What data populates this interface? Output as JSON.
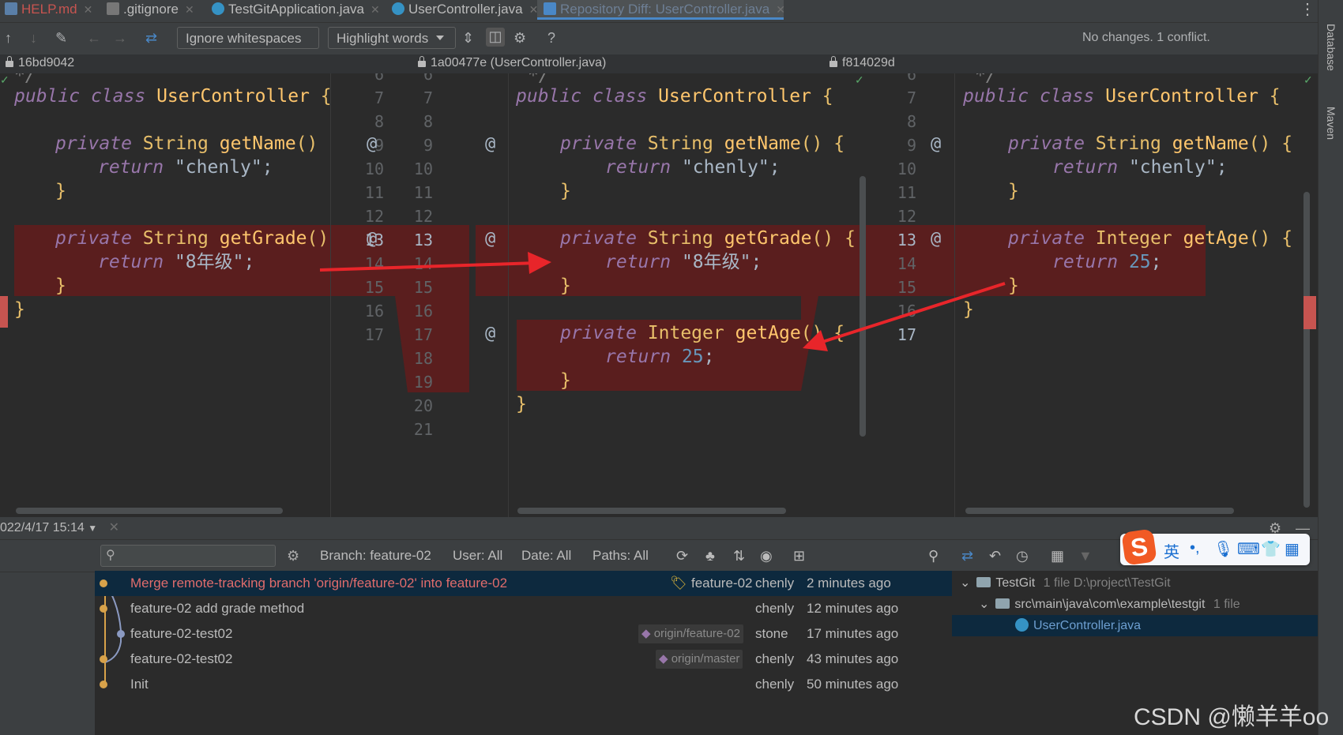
{
  "tabs": [
    {
      "label": "HELP.md",
      "icon": "markdown-icon"
    },
    {
      "label": ".gitignore",
      "icon": "gitignore-icon"
    },
    {
      "label": "TestGitApplication.java",
      "icon": "java-class-icon"
    },
    {
      "label": "UserController.java",
      "icon": "java-class-icon"
    },
    {
      "label": "Repository Diff: UserController.java",
      "icon": "diff-icon"
    }
  ],
  "toolbar": {
    "whitespace_option": "Ignore whitespaces",
    "highlight_option": "Highlight words",
    "help": "?",
    "status": "No changes. 1 conflict."
  },
  "revisions": {
    "left": "16bd9042",
    "center": "1a00477e (UserController.java)",
    "right": "f814029d"
  },
  "code": {
    "comment_end": "*/",
    "class_decl": {
      "kw1": "public",
      "kw2": "class",
      "name": "UserController",
      "brace": "{"
    },
    "getName": {
      "kw": "private",
      "type": "String",
      "name": "getName",
      "paren": "()",
      "brace": "{",
      "ret": "return",
      "value": "\"chenly\"",
      "semi": ";",
      "close": "}"
    },
    "getGrade": {
      "kw": "private",
      "type": "String",
      "name": "getGrade",
      "paren": "()",
      "brace": "{",
      "ret": "return",
      "value": "\"8年级\"",
      "semi": ";",
      "close": "}"
    },
    "getAge": {
      "kw": "private",
      "type": "Integer",
      "name": "getAge",
      "paren": "()",
      "brace": "{",
      "ret": "return",
      "value": "25",
      "semi": ";",
      "close": "}"
    },
    "class_close": "}"
  },
  "gutter": {
    "left_numbers": [
      "6",
      "7",
      "8",
      "9",
      "10",
      "11",
      "12",
      "13",
      "14",
      "15",
      "16",
      "17"
    ],
    "center_numbers": [
      "6",
      "7",
      "8",
      "9",
      "10",
      "11",
      "12",
      "13",
      "14",
      "15",
      "16",
      "17",
      "18",
      "19",
      "20",
      "21"
    ],
    "right_numbers": [
      "6",
      "7",
      "8",
      "9",
      "10",
      "11",
      "12",
      "13",
      "14",
      "15",
      "16",
      "17"
    ],
    "annotation_marker": "@"
  },
  "log": {
    "date_filter": "022/4/17 15:14",
    "filters": {
      "branch": "Branch: feature-02",
      "user": "User: All",
      "date": "Date: All",
      "paths": "Paths: All"
    },
    "commits": [
      {
        "message": "Merge remote-tracking branch 'origin/feature-02' into feature-02",
        "tag": "feature-02",
        "author": "chenly",
        "time": "2 minutes ago"
      },
      {
        "message": "feature-02 add grade method",
        "tag": "",
        "author": "chenly",
        "time": "12 minutes ago"
      },
      {
        "message": "feature-02-test02",
        "tag": "origin/feature-02",
        "author": "stone",
        "time": "17 minutes ago"
      },
      {
        "message": "feature-02-test02",
        "tag": "origin/master",
        "author": "chenly",
        "time": "43 minutes ago"
      },
      {
        "message": "Init",
        "tag": "",
        "author": "chenly",
        "time": "50 minutes ago"
      }
    ]
  },
  "tree": {
    "root": {
      "label": "TestGit",
      "meta": "1 file  D:\\project\\TestGit"
    },
    "folder": {
      "label": "src\\main\\java\\com\\example\\testgit",
      "meta": "1 file"
    },
    "file": "UserController.java"
  },
  "side_tools": [
    "Database",
    "Maven"
  ],
  "ime": {
    "lang": "英",
    "punct": "•,"
  },
  "watermark": "CSDN @懒羊羊oo",
  "colors": {
    "conflict": "#5a1e1e",
    "selection": "#0d293e",
    "arrow": "#e8252a",
    "accent_tab": "#4a88c7"
  }
}
